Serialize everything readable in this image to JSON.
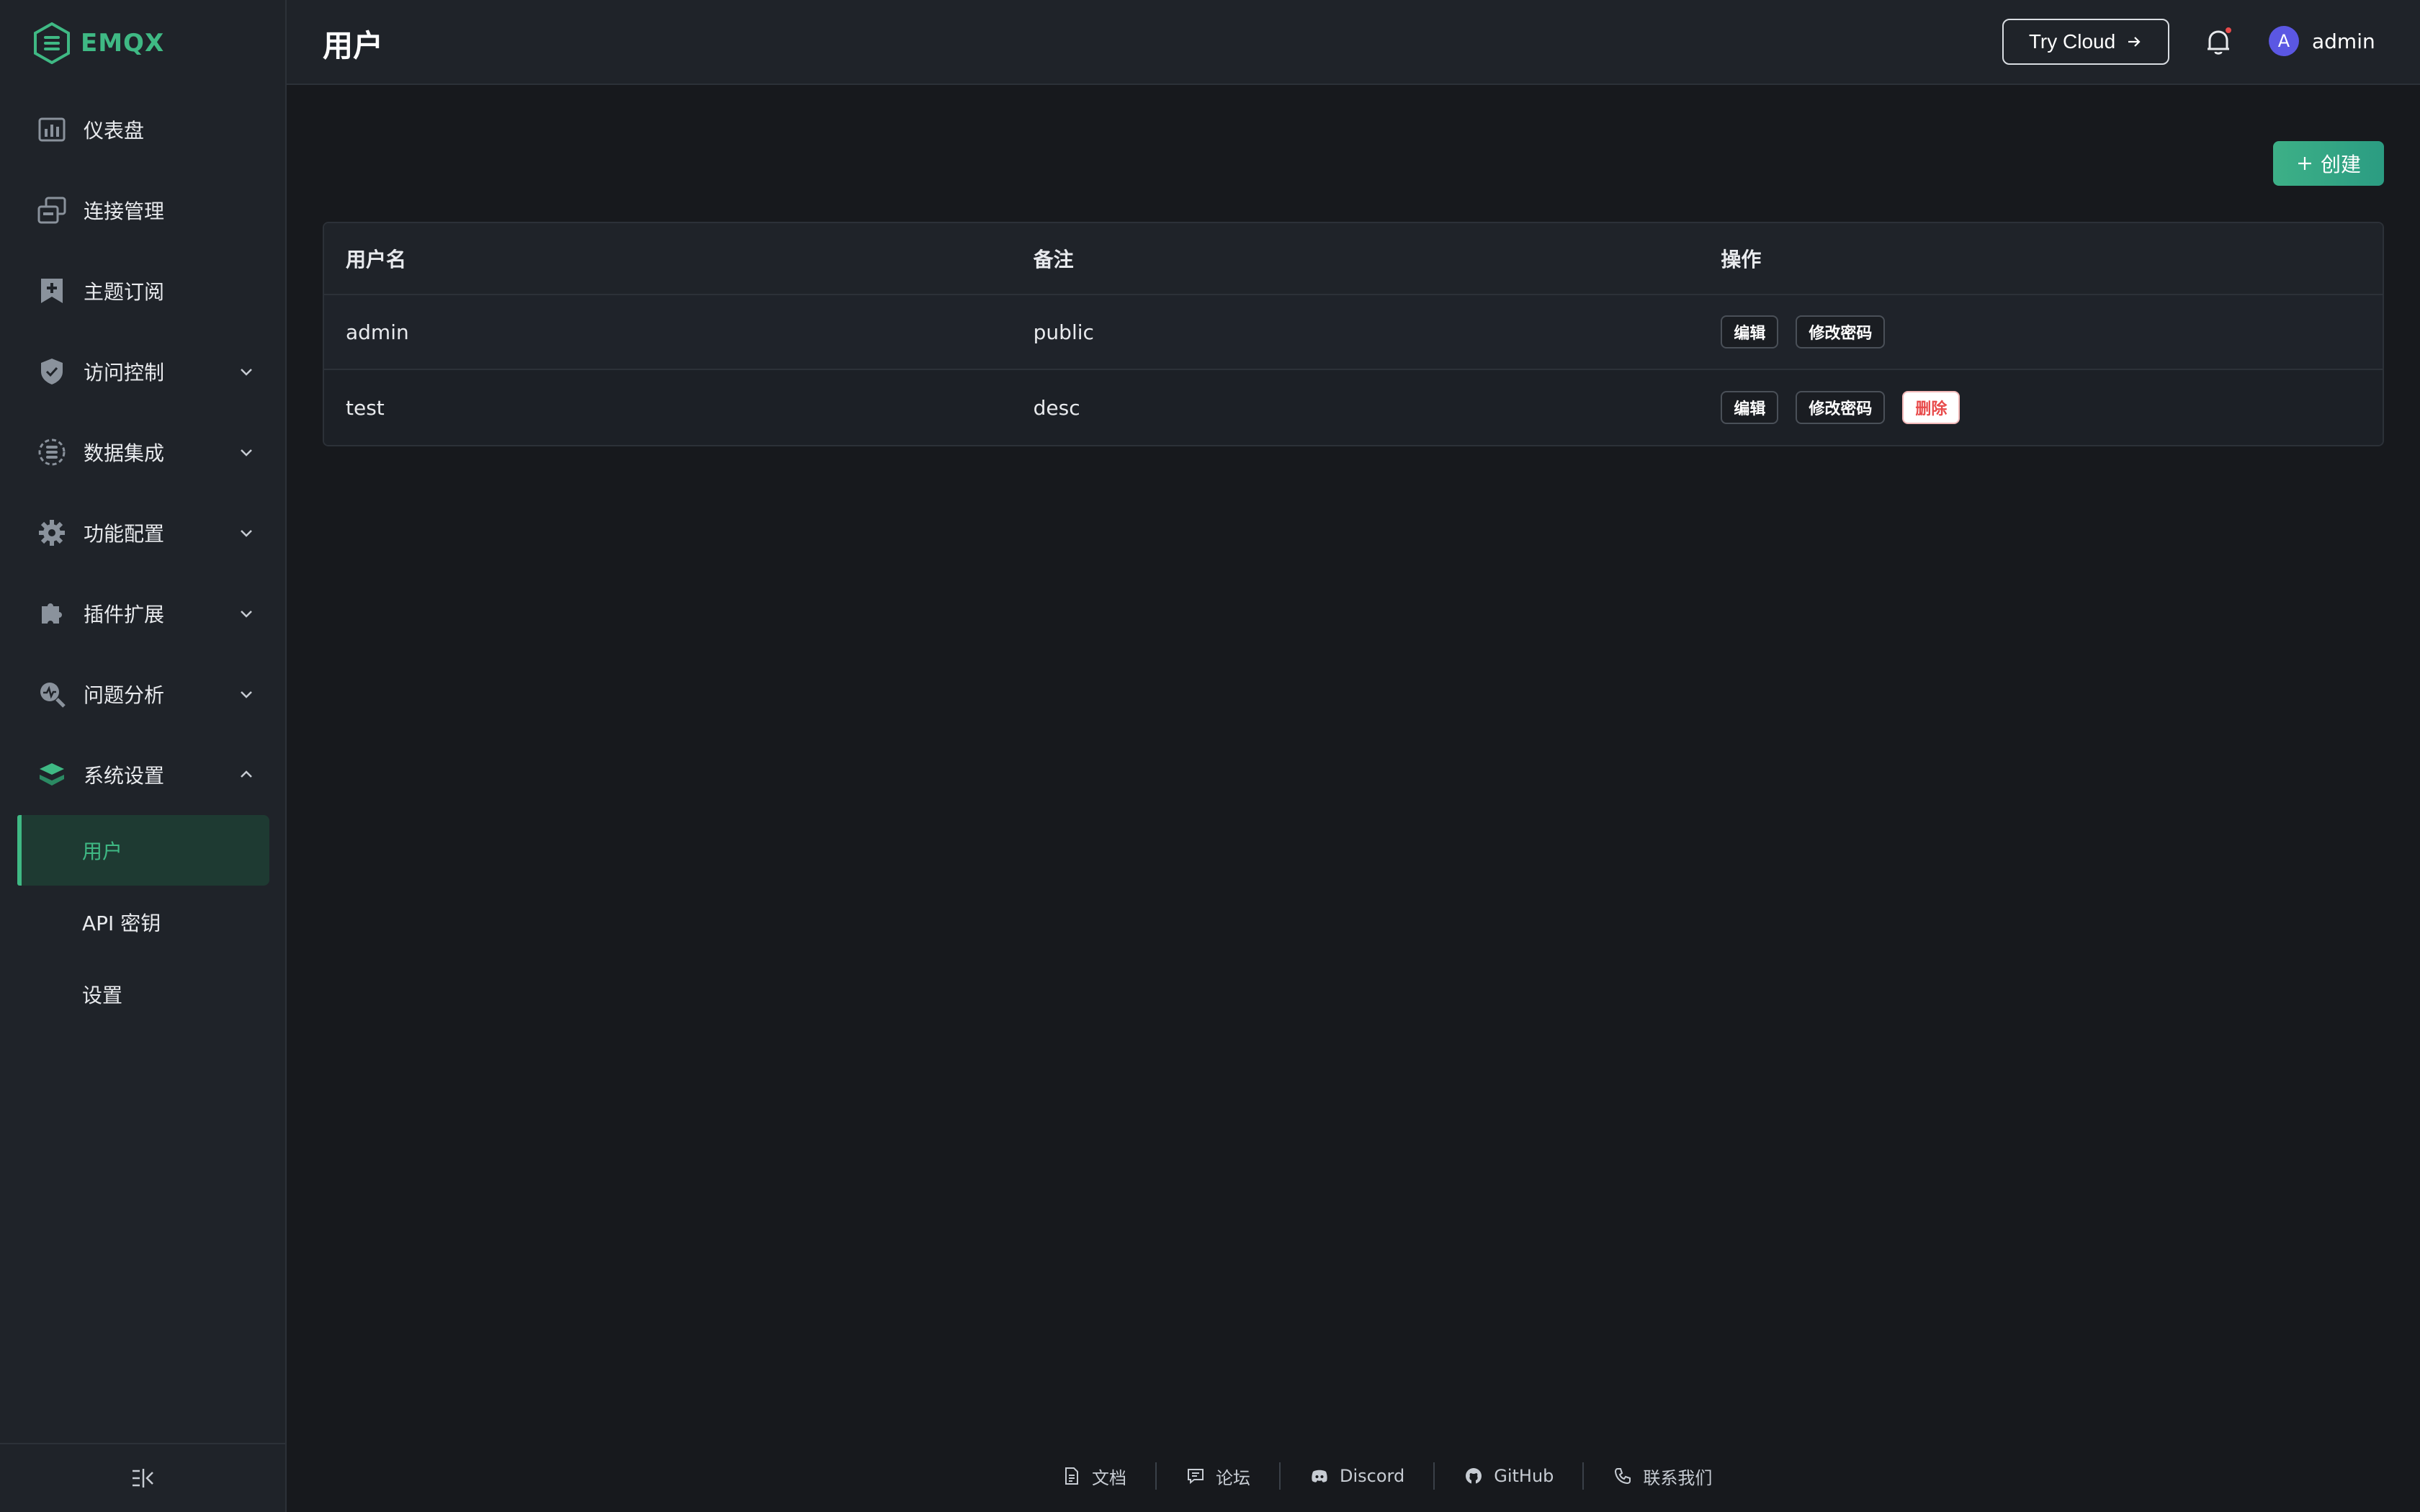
{
  "app": {
    "name": "EMQX",
    "accent": "#3fb984"
  },
  "header": {
    "title": "用户",
    "try_cloud_label": "Try Cloud",
    "avatar_initial": "A",
    "user_name": "admin"
  },
  "sidebar": {
    "items": [
      {
        "label": "仪表盘",
        "icon": "dashboard-icon"
      },
      {
        "label": "连接管理",
        "icon": "connections-icon"
      },
      {
        "label": "主题订阅",
        "icon": "subscription-icon"
      },
      {
        "label": "访问控制",
        "icon": "shield-icon",
        "expandable": true
      },
      {
        "label": "数据集成",
        "icon": "data-integration-icon",
        "expandable": true
      },
      {
        "label": "功能配置",
        "icon": "gear-icon",
        "expandable": true
      },
      {
        "label": "插件扩展",
        "icon": "puzzle-icon",
        "expandable": true
      },
      {
        "label": "问题分析",
        "icon": "diagnosis-icon",
        "expandable": true
      },
      {
        "label": "系统设置",
        "icon": "system-settings-icon",
        "expanded": true
      }
    ],
    "sub_items": [
      {
        "label": "用户",
        "active": true
      },
      {
        "label": "API 密钥"
      },
      {
        "label": "设置"
      }
    ]
  },
  "main": {
    "create_label": "创建",
    "table": {
      "columns": [
        "用户名",
        "备注",
        "操作"
      ],
      "rows": [
        {
          "username": "admin",
          "note": "public",
          "actions": [
            "编辑",
            "修改密码"
          ]
        },
        {
          "username": "test",
          "note": "desc",
          "actions": [
            "编辑",
            "修改密码",
            "删除"
          ]
        }
      ]
    }
  },
  "footer": {
    "links": [
      {
        "label": "文档",
        "icon": "doc-icon"
      },
      {
        "label": "论坛",
        "icon": "forum-icon"
      },
      {
        "label": "Discord",
        "icon": "discord-icon"
      },
      {
        "label": "GitHub",
        "icon": "github-icon"
      },
      {
        "label": "联系我们",
        "icon": "phone-icon"
      }
    ]
  }
}
